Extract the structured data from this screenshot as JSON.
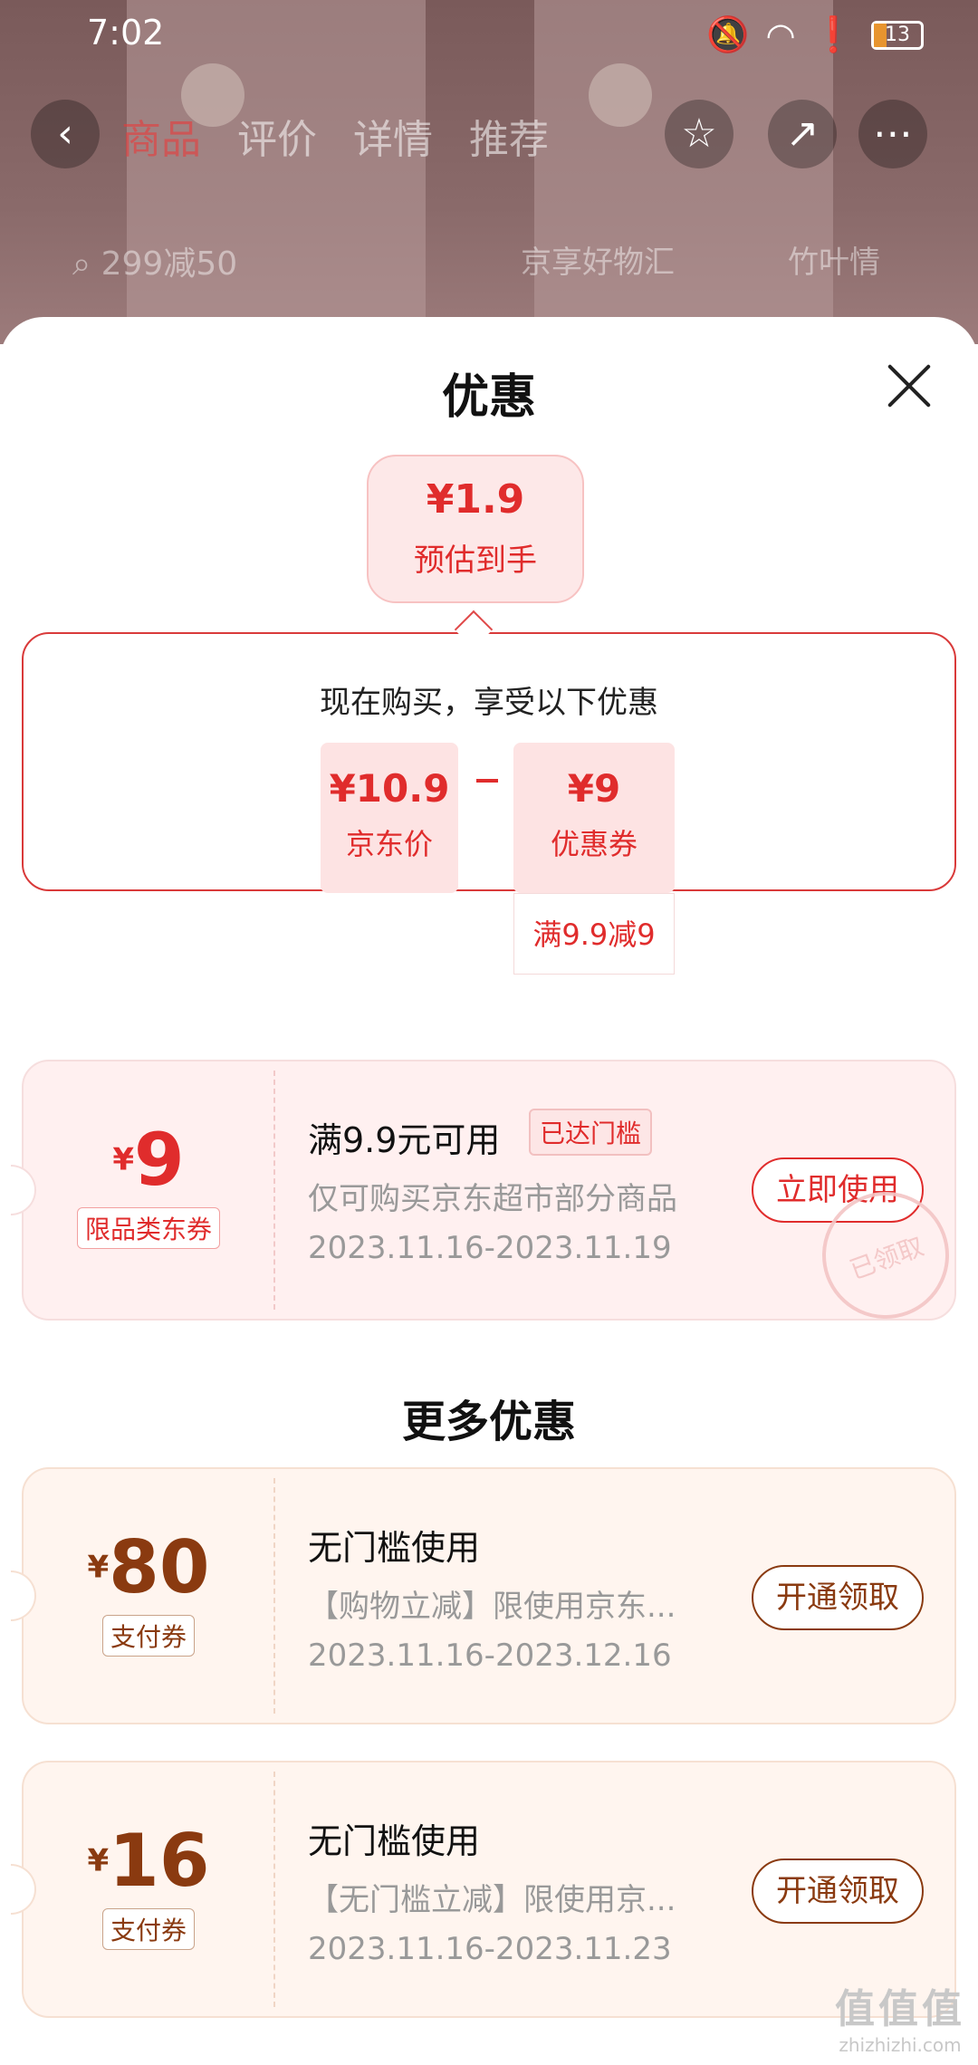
{
  "status_bar": {
    "time": "7:02",
    "battery": "13"
  },
  "background": {
    "tabs": [
      "商品",
      "评价",
      "详情",
      "推荐"
    ],
    "search_placeholder": "299减50",
    "search_chip_1": "京享好物汇",
    "search_chip_2": "竹叶情"
  },
  "sheet": {
    "title": "优惠",
    "estimate": {
      "price": "¥1.9",
      "label": "预估到手"
    },
    "calc": {
      "headline": "现在购买，享受以下优惠",
      "jd_price": "¥10.9",
      "jd_price_label": "京东价",
      "coupon_value": "¥9",
      "coupon_label": "优惠券",
      "coupon_rule": "满9.9减9"
    },
    "main_coupon": {
      "currency": "¥",
      "amount": "9",
      "tag": "限品类东券",
      "condition": "满9.9元可用",
      "reached": "已达门槛",
      "scope": "仅可购买京东超市部分商品",
      "dates": "2023.11.16-2023.11.19",
      "button": "立即使用",
      "stamp": "已领取"
    },
    "more_title": "更多优惠",
    "more_coupons": [
      {
        "currency": "¥",
        "amount": "80",
        "tag": "支付券",
        "condition": "无门槛使用",
        "scope": "【购物立减】限使用京东...",
        "dates": "2023.11.16-2023.12.16",
        "button": "开通领取"
      },
      {
        "currency": "¥",
        "amount": "16",
        "tag": "支付券",
        "condition": "无门槛使用",
        "scope": "【无门槛立减】限使用京...",
        "dates": "2023.11.16-2023.11.23",
        "button": "开通领取"
      }
    ]
  },
  "watermark": {
    "line1": "值值值",
    "line2": "zhizhizhi.com"
  },
  "colors": {
    "red": "#e02c2c",
    "brown": "#8a3a10",
    "ticket_pink": "#fff0f0",
    "ticket_cream": "#fff5ef"
  }
}
